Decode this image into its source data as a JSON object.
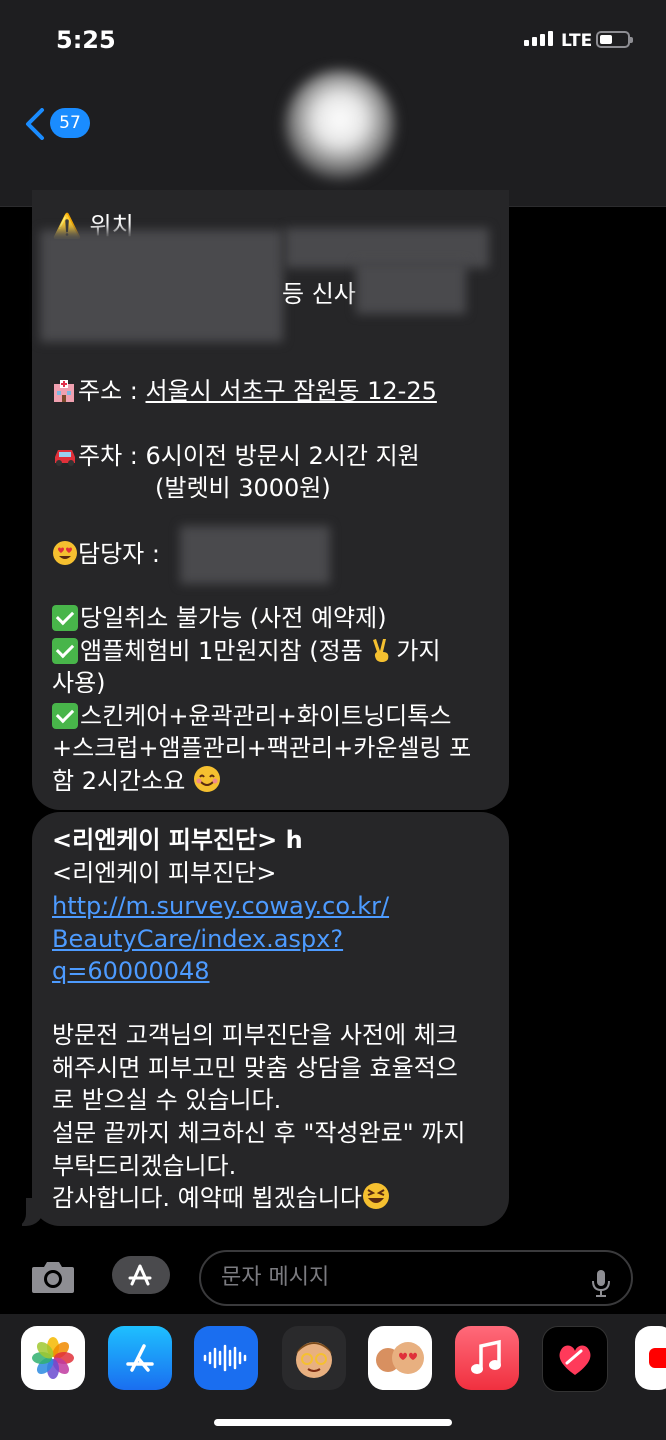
{
  "status_bar": {
    "time": "5:25",
    "network": "LTE"
  },
  "header": {
    "back_badge_count": "57"
  },
  "message1": {
    "location_label": "⚠️ 위치",
    "partial_text_1": "등 신사",
    "address_label": "주소 :",
    "address_value": "서울시 서초구 잠원동 12-25",
    "parking_label": "주차 :",
    "parking_value_1": "6시이전 방문시 2시간 지원",
    "parking_value_2": "(발렛비 3000원)",
    "manager_label": "담당자 :",
    "check_1": "당일취소 불가능 (사전 예약제)",
    "check_2": "앰플체험비 1만원지참 (정품",
    "check_2_end": "가지",
    "check_2_line2": "사용)",
    "check_3_line1": "스킨케어+윤곽관리+화이트닝디톡스",
    "check_3_line2": "+스크럽+앰플관리+팩관리+카운셀링 포",
    "check_3_line3": "함 2시간소요"
  },
  "message2": {
    "title": "<리엔케이 피부진단> h",
    "subtitle": "<리엔케이 피부진단>",
    "link_line1": "http://m.survey.coway.co.kr/",
    "link_line2": "BeautyCare/index.aspx?",
    "link_line3": "q=60000048",
    "body_1": "방문전 고객님의 피부진단을 사전에 체크",
    "body_2": "해주시면 피부고민 맞춤 상담을 효율적으",
    "body_3": "로 받으실 수 있습니다.",
    "body_4": "설문 끝까지 체크하신 후 \"작성완료\" 까지",
    "body_5": "부탁드리겠습니다.",
    "body_6": "감사합니다. 예약때 뵙겠습니다"
  },
  "composer": {
    "placeholder": "문자 메시지"
  },
  "app_drawer": [
    "photos-app-icon",
    "app-store-icon",
    "audio-message-icon",
    "memoji-icon",
    "memoji-stickers-icon",
    "music-app-icon",
    "digital-touch-icon",
    "youtube-icon"
  ]
}
